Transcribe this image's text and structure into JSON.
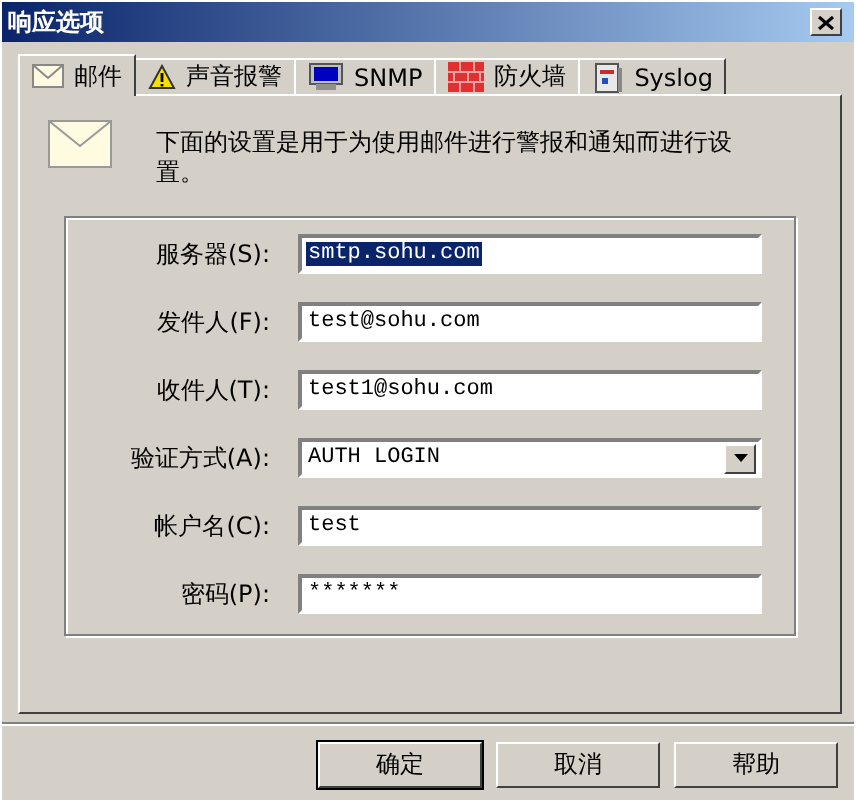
{
  "window": {
    "title": "响应选项"
  },
  "tabs": [
    {
      "label": "邮件",
      "kind": "mail",
      "selected": true
    },
    {
      "label": "声音报警",
      "kind": "sound",
      "selected": false
    },
    {
      "label": "SNMP",
      "kind": "snmp",
      "selected": false
    },
    {
      "label": "防火墙",
      "kind": "firewall",
      "selected": false
    },
    {
      "label": "Syslog",
      "kind": "syslog",
      "selected": false
    }
  ],
  "description": "下面的设置是用于为使用邮件进行警报和通知而进行设置。",
  "fields": [
    {
      "label": "服务器(S):",
      "kind": "text",
      "value": "smtp.sohu.com",
      "selected": true
    },
    {
      "label": "发件人(F):",
      "kind": "text",
      "value": "test@sohu.com",
      "selected": false
    },
    {
      "label": "收件人(T):",
      "kind": "text",
      "value": "test1@sohu.com",
      "selected": false
    },
    {
      "label": "验证方式(A):",
      "kind": "combo",
      "value": "AUTH LOGIN",
      "selected": false
    },
    {
      "label": "帐户名(C):",
      "kind": "text",
      "value": "test",
      "selected": false
    },
    {
      "label": "密码(P):",
      "kind": "password",
      "value": "*******",
      "selected": false
    }
  ],
  "buttons": [
    {
      "label": "确定",
      "default": true
    },
    {
      "label": "取消",
      "default": false
    },
    {
      "label": "帮助",
      "default": false
    }
  ]
}
